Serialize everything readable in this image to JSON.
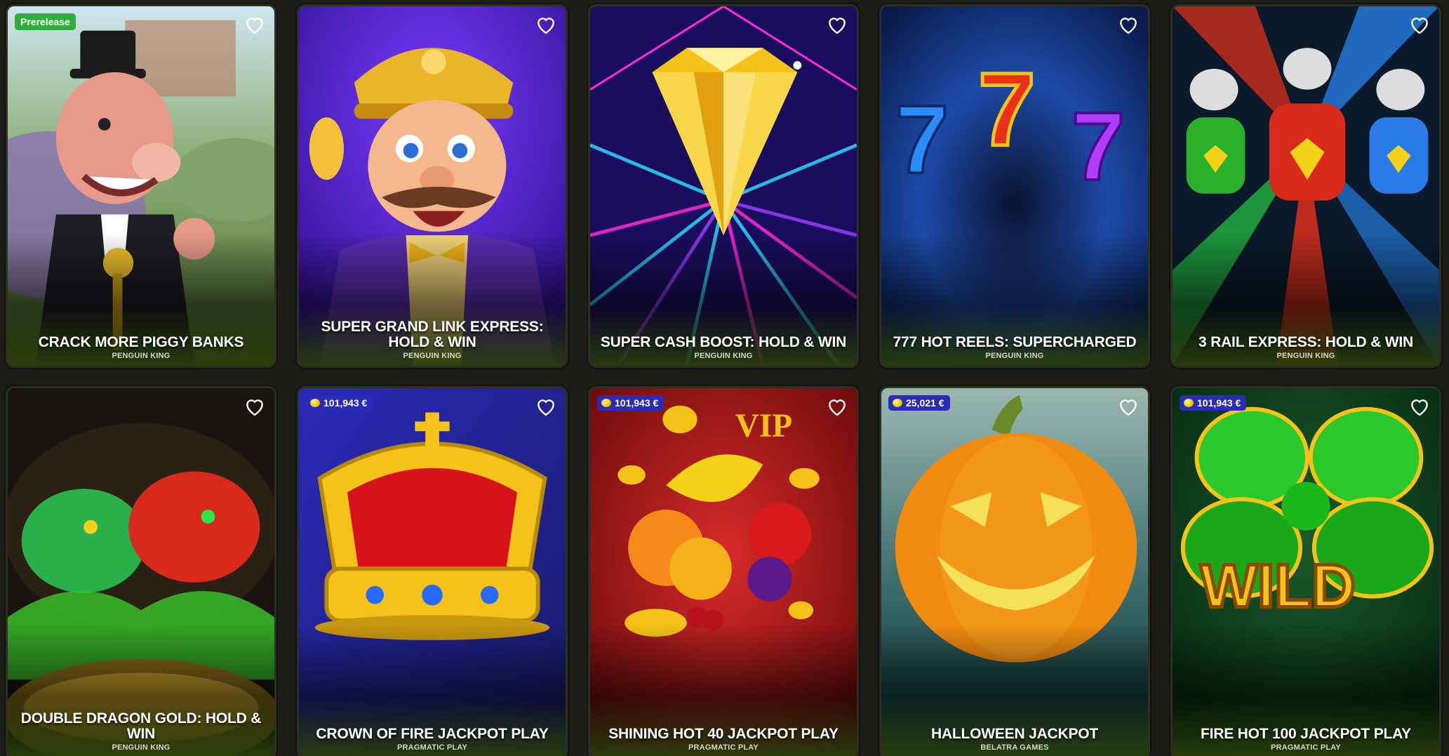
{
  "colors": {
    "background": "#1c1d17",
    "prerelease_badge": "#2fae3d",
    "jackpot_badge": "#2a2bb8"
  },
  "games": [
    {
      "title": "CRACK MORE PIGGY BANKS",
      "provider": "PENGUIN KING",
      "badge": "Prerelease",
      "jackpot": null,
      "theme": "pig"
    },
    {
      "title": "SUPER GRAND LINK EXPRESS: HOLD & WIN",
      "provider": "PENGUIN KING",
      "badge": null,
      "jackpot": null,
      "theme": "conductor"
    },
    {
      "title": "SUPER CASH BOOST: HOLD & WIN",
      "provider": "PENGUIN KING",
      "badge": null,
      "jackpot": null,
      "theme": "diamond"
    },
    {
      "title": "777 HOT REELS: SUPERCHARGED",
      "provider": "PENGUIN KING",
      "badge": null,
      "jackpot": null,
      "theme": "sevens"
    },
    {
      "title": "3 RAIL EXPRESS: HOLD & WIN",
      "provider": "PENGUIN KING",
      "badge": null,
      "jackpot": null,
      "theme": "trains"
    },
    {
      "title": "DOUBLE DRAGON GOLD: HOLD & WIN",
      "provider": "PENGUIN KING",
      "badge": null,
      "jackpot": null,
      "theme": "dragons"
    },
    {
      "title": "CROWN OF FIRE JACKPOT PLAY",
      "provider": "PRAGMATIC PLAY",
      "badge": null,
      "jackpot": "101,943 €",
      "theme": "crown"
    },
    {
      "title": "SHINING HOT 40 JACKPOT PLAY",
      "provider": "PRAGMATIC PLAY",
      "badge": null,
      "jackpot": "101,943 €",
      "theme": "fruits"
    },
    {
      "title": "HALLOWEEN JACKPOT",
      "provider": "BELATRA GAMES",
      "badge": null,
      "jackpot": "25,021 €",
      "theme": "pumpkin"
    },
    {
      "title": "FIRE HOT 100 JACKPOT PLAY",
      "provider": "PRAGMATIC PLAY",
      "badge": null,
      "jackpot": "101,943 €",
      "theme": "clover"
    }
  ],
  "icons": {
    "favorite": "heart-outline-icon",
    "jackpot": "coin-icon"
  }
}
